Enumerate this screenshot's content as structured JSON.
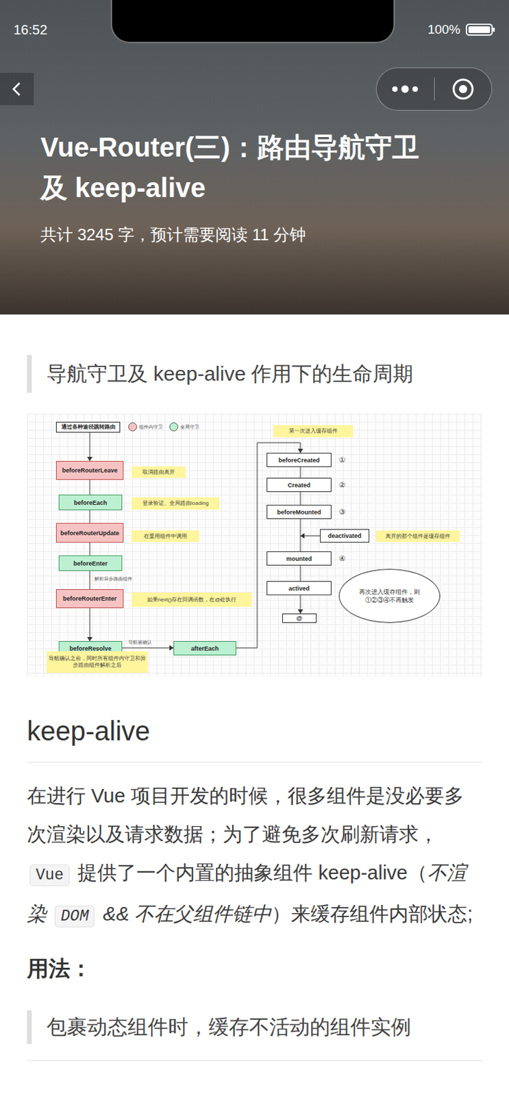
{
  "status_bar": {
    "time": "16:52",
    "battery": "100%"
  },
  "header": {
    "title_lines": [
      "Vue-Router(三)：路由导航守卫",
      "及 keep-alive"
    ],
    "subtitle": "共计 3245 字，预计需要阅读 11 分钟"
  },
  "article": {
    "quote": "导航守卫及 keep-alive 作用下的生命周期",
    "diagram": {
      "legend": [
        {
          "label": "组件内守卫",
          "kind": "component",
          "color": "#f6c3c3"
        },
        {
          "label": "全局守卫",
          "kind": "global",
          "color": "#bdf0d2"
        }
      ],
      "nodes": [
        {
          "label": "通过各种途径跳转路由",
          "kind": "start",
          "marker": ""
        },
        {
          "label": "beforeRouterLeave",
          "kind": "component",
          "marker": ""
        },
        {
          "label": "beforeEach",
          "kind": "global",
          "marker": ""
        },
        {
          "label": "beforeRouterUpdate",
          "kind": "component",
          "marker": ""
        },
        {
          "label": "beforeEnter",
          "kind": "global",
          "marker": ""
        },
        {
          "label": "beforeRouterEnter",
          "kind": "component",
          "marker": ""
        },
        {
          "label": "beforeResolve",
          "kind": "global",
          "marker": ""
        },
        {
          "label": "afterEach",
          "kind": "global",
          "marker": ""
        },
        {
          "label": "beforeCreated",
          "kind": "lifecycle",
          "marker": "①"
        },
        {
          "label": "Created",
          "kind": "lifecycle",
          "marker": "②"
        },
        {
          "label": "beforeMounted",
          "kind": "lifecycle",
          "marker": "③"
        },
        {
          "label": "deactivated",
          "kind": "lifecycle",
          "marker": ""
        },
        {
          "label": "mounted",
          "kind": "lifecycle",
          "marker": "④"
        },
        {
          "label": "actived",
          "kind": "lifecycle",
          "marker": ""
        },
        {
          "label": "@",
          "kind": "lifecycle",
          "marker": ""
        }
      ],
      "notes": [
        "取消路由离开",
        "登录验证、全局路由loading",
        "在重用组件中调用",
        "如果next()存在回调函数，在@处执行",
        "导航确认之前，同时所有组件内守卫和异步路由组件解析之后",
        "第一次进入缓存组件",
        "离开的那个组件是缓存组件"
      ],
      "edge_labels": [
        "解析异步路由组件",
        "导航被确认"
      ],
      "cloud": "再次进入缓存组件，则①②③④不再触发"
    },
    "heading": "keep-alive",
    "paragraph": [
      {
        "kind": "text",
        "text": "在进行 Vue 项目开发的时候，很多组件是没必要多次渲染以及请求数据；为了避免多次刷新请求，"
      },
      {
        "kind": "code",
        "text": "Vue"
      },
      {
        "kind": "text",
        "text": " 提供了一个内置的抽象组件 keep-alive（"
      },
      {
        "kind": "italic",
        "text": "不渲染 "
      },
      {
        "kind": "code",
        "text": "DOM"
      },
      {
        "kind": "italic",
        "text": " && 不在父组件链中"
      },
      {
        "kind": "text",
        "text": "）来缓存组件内部状态;"
      }
    ],
    "usage_heading": "用法：",
    "usage_quote": "包裹动态组件时，缓存不活动的组件实例"
  }
}
